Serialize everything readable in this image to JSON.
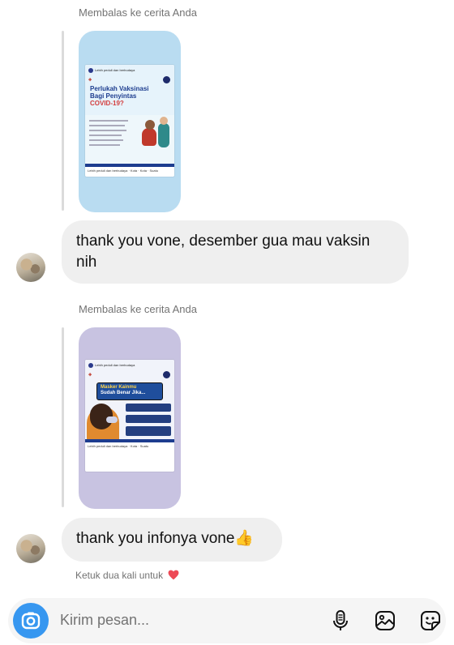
{
  "thread": {
    "messages": [
      {
        "reply_context": "Membalas ke cerita Anda",
        "story": {
          "theme_color": "#b9dcf1",
          "org_label": "Lebih peduli dan berbudaya",
          "headline_1": "Perlukah Vaksinasi",
          "headline_2": "Bagi Penyintas",
          "headline_3": "COVID-19?",
          "footer_text": "Lebih peduli dan berbudaya · Kota · Kota · Suatu"
        },
        "text": "thank you vone, desember gua mau vaksin nih"
      },
      {
        "reply_context": "Membalas ke cerita Anda",
        "story": {
          "theme_color": "#c8c3e1",
          "org_label": "Lebih peduli dan berbudaya",
          "headline_1": "Masker Kainmu",
          "headline_2": "Sudah Benar Jika...",
          "footer_text": "Lebih peduli dan berbudaya · Kota · Suatu"
        },
        "text": "thank you infonya vone",
        "emoji": "👍"
      }
    ],
    "double_tap_hint": "Ketuk dua kali untuk",
    "heart_color": "#ed4956"
  },
  "composer": {
    "placeholder": "Kirim pesan...",
    "camera_color": "#3797f0",
    "icons": [
      "camera-icon",
      "microphone-icon",
      "gallery-icon",
      "sticker-icon"
    ]
  }
}
